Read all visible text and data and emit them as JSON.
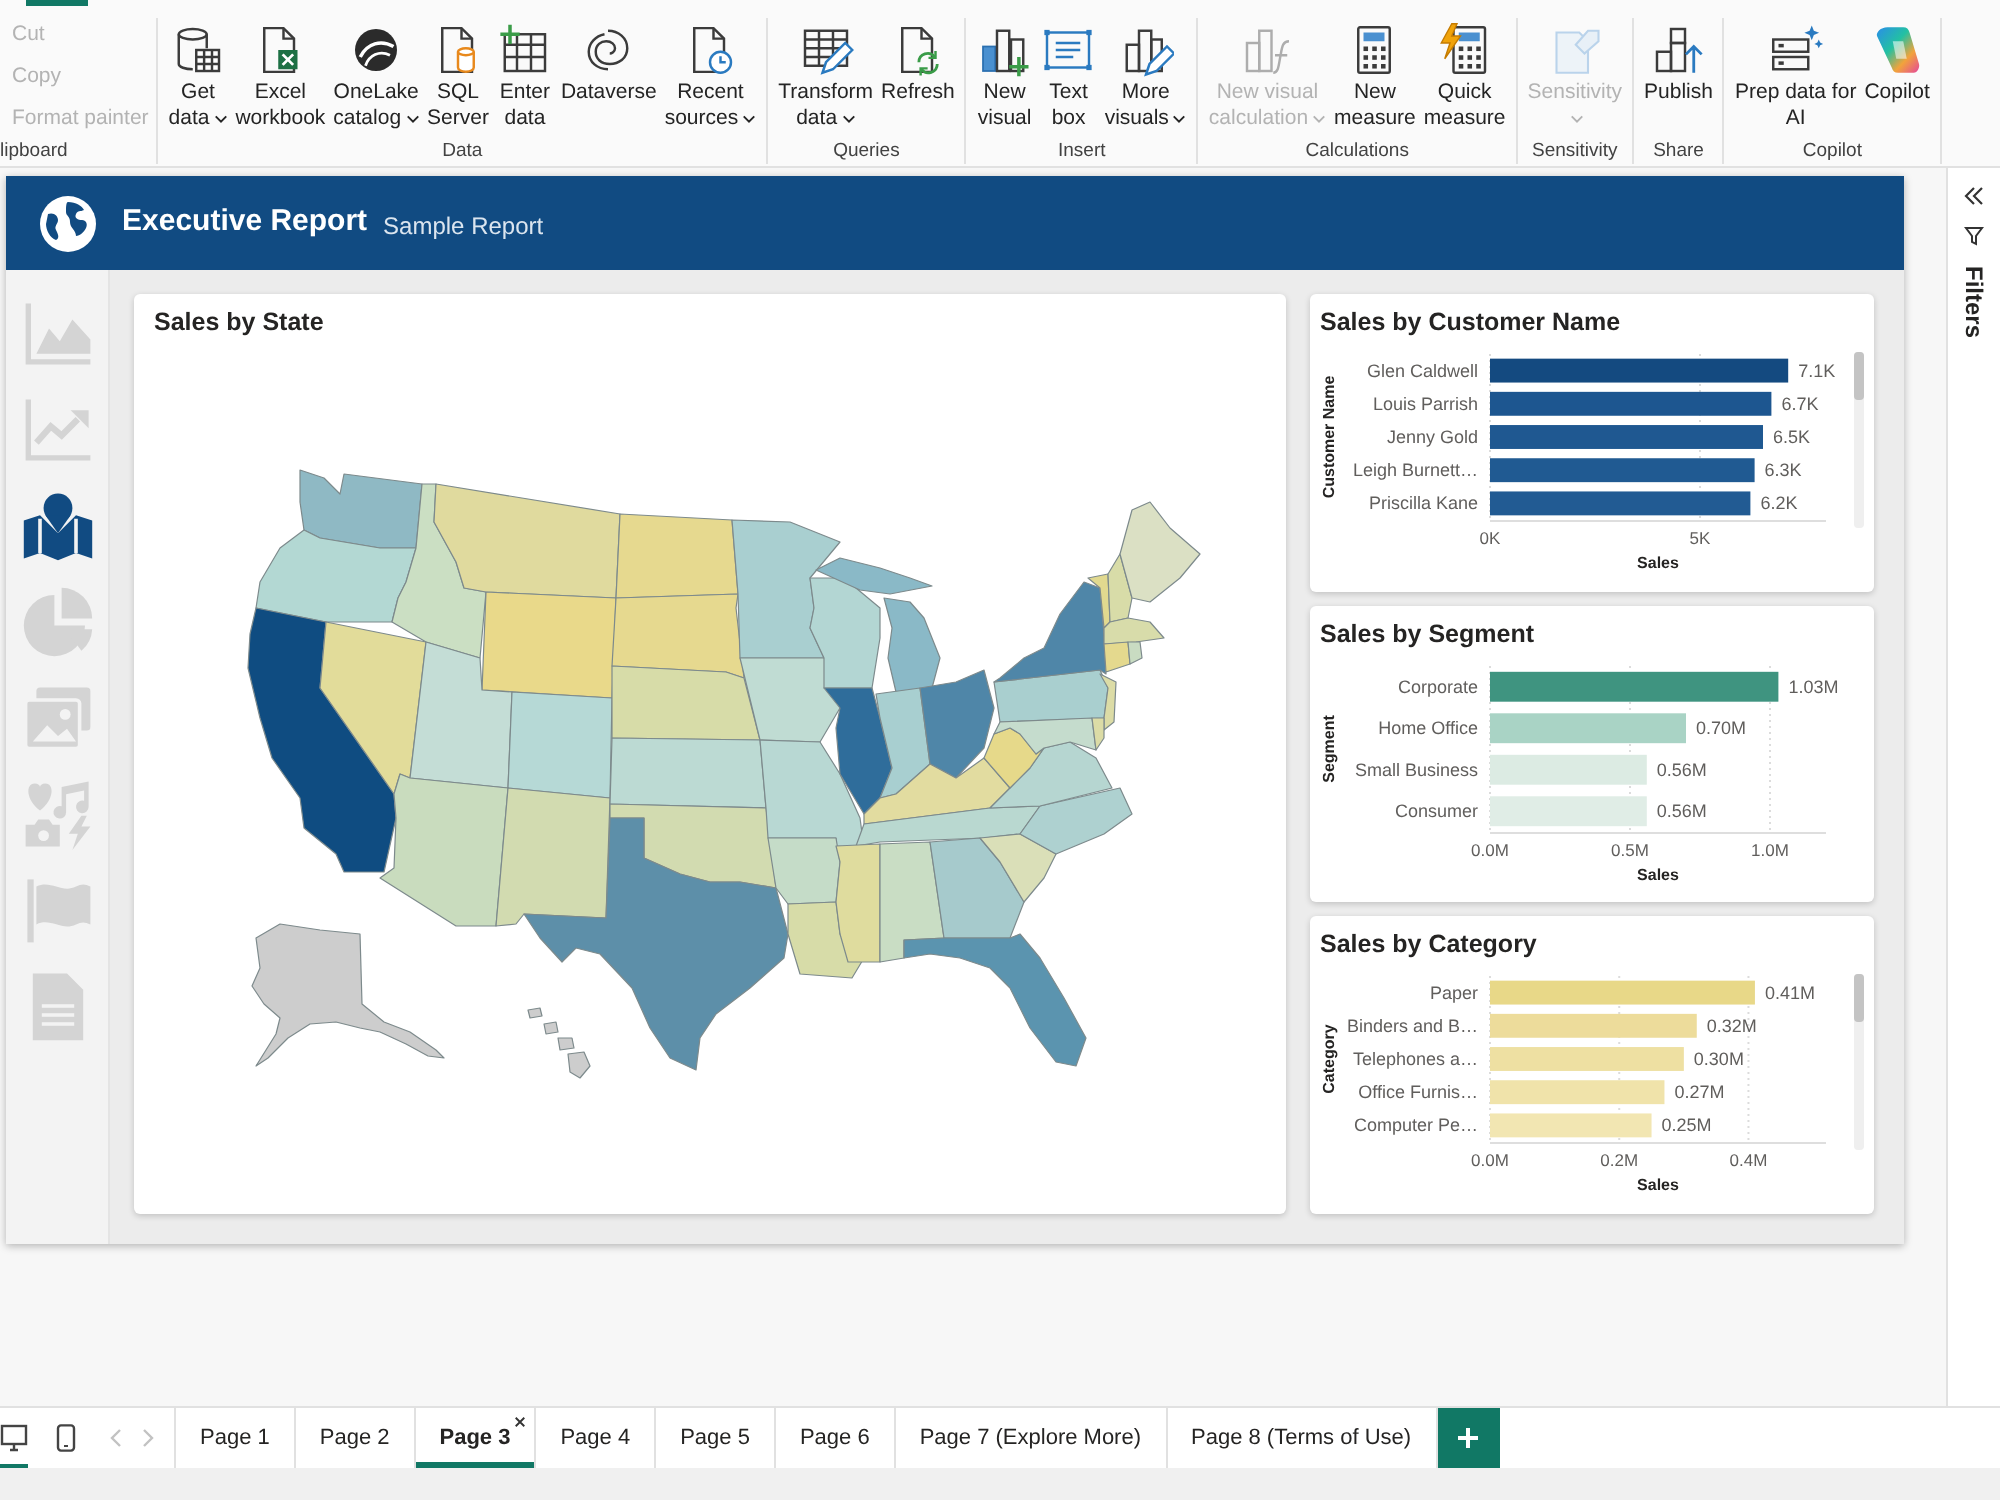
{
  "ribbon": {
    "groups": [
      {
        "kind": "stack",
        "label": "lipboard",
        "buttons": [
          {
            "label": [
              "Cut"
            ],
            "disabled": true,
            "dropdown": false
          },
          {
            "label": [
              "Copy"
            ],
            "disabled": true,
            "dropdown": false
          },
          {
            "label": [
              "Format painter"
            ],
            "disabled": true,
            "dropdown": false
          }
        ]
      },
      {
        "kind": "large",
        "label": "Data",
        "buttons": [
          {
            "kind": "getdata",
            "label": [
              "Get",
              "data"
            ],
            "dropdown": true,
            "disabled": false
          },
          {
            "kind": "excel",
            "label": [
              "Excel",
              "workbook"
            ],
            "dropdown": false,
            "disabled": false
          },
          {
            "kind": "onelake",
            "label": [
              "OneLake",
              "catalog"
            ],
            "dropdown": true,
            "disabled": false
          },
          {
            "kind": "sql",
            "label": [
              "SQL",
              "Server"
            ],
            "dropdown": false,
            "disabled": false
          },
          {
            "kind": "enterdata",
            "label": [
              "Enter",
              "data"
            ],
            "dropdown": false,
            "disabled": false
          },
          {
            "kind": "dataverse",
            "label": [
              "Dataverse"
            ],
            "dropdown": false,
            "disabled": false
          },
          {
            "kind": "recent",
            "label": [
              "Recent",
              "sources"
            ],
            "dropdown": true,
            "disabled": false
          }
        ]
      },
      {
        "kind": "large",
        "label": "Queries",
        "buttons": [
          {
            "kind": "transform",
            "label": [
              "Transform",
              "data"
            ],
            "dropdown": true,
            "disabled": false
          },
          {
            "kind": "refresh",
            "label": [
              "Refresh"
            ],
            "dropdown": false,
            "disabled": false
          }
        ]
      },
      {
        "kind": "large",
        "label": "Insert",
        "buttons": [
          {
            "kind": "newvisual",
            "label": [
              "New",
              "visual"
            ],
            "dropdown": false,
            "disabled": false
          },
          {
            "kind": "textbox",
            "label": [
              "Text",
              "box"
            ],
            "dropdown": false,
            "disabled": false
          },
          {
            "kind": "morevisuals",
            "label": [
              "More",
              "visuals"
            ],
            "dropdown": true,
            "disabled": false
          }
        ]
      },
      {
        "kind": "large",
        "label": "Calculations",
        "buttons": [
          {
            "kind": "visualcalc",
            "label": [
              "New visual",
              "calculation"
            ],
            "dropdown": true,
            "disabled": true
          },
          {
            "kind": "measure",
            "label": [
              "New",
              "measure"
            ],
            "dropdown": false,
            "disabled": false
          },
          {
            "kind": "quickmeasure",
            "label": [
              "Quick",
              "measure"
            ],
            "dropdown": false,
            "disabled": false
          }
        ]
      },
      {
        "kind": "large",
        "label": "Sensitivity",
        "buttons": [
          {
            "kind": "sensitivity",
            "label": [
              "Sensitivity"
            ],
            "dropdown": true,
            "disabled": true
          }
        ]
      },
      {
        "kind": "large",
        "label": "Share",
        "buttons": [
          {
            "kind": "publish",
            "label": [
              "Publish"
            ],
            "dropdown": false,
            "disabled": false
          }
        ]
      },
      {
        "kind": "large",
        "label": "Copilot",
        "buttons": [
          {
            "kind": "prepdata",
            "label": [
              "Prep data for",
              "AI"
            ],
            "dropdown": false,
            "disabled": false
          },
          {
            "kind": "copilot",
            "label": [
              "Copilot"
            ],
            "dropdown": false,
            "disabled": false
          }
        ]
      }
    ]
  },
  "report": {
    "title": "Executive Report",
    "subtitle": "Sample Report",
    "nav": [
      {
        "kind": "area",
        "selected": false
      },
      {
        "kind": "line",
        "selected": false
      },
      {
        "kind": "map",
        "selected": true
      },
      {
        "kind": "pie",
        "selected": false
      },
      {
        "kind": "gallery",
        "selected": false
      },
      {
        "kind": "media",
        "selected": false
      },
      {
        "kind": "flag",
        "selected": false
      },
      {
        "kind": "document",
        "selected": false
      }
    ],
    "visuals": [
      {
        "kind": "map",
        "title": "Sales by State"
      },
      {
        "kind": "bar",
        "title": "Sales by Customer Name",
        "chart_data": {
          "type": "bar",
          "orientation": "horizontal",
          "stacked": true,
          "xlabel": "Sales",
          "ylabel": "Customer Name",
          "categories": [
            "Glen Caldwell",
            "Louis Parrish",
            "Jenny Gold",
            "Leigh Burnett…",
            "Priscilla Kane"
          ],
          "series": [
            {
              "color": "#144a80",
              "values": [
                7.1,
                null,
                null,
                null,
                null
              ]
            },
            {
              "color": "#1d5690",
              "values": [
                null,
                6.7,
                null,
                null,
                null
              ]
            },
            {
              "color": "#1f5891",
              "values": [
                null,
                null,
                6.5,
                null,
                null
              ]
            },
            {
              "color": "#205a92",
              "values": [
                null,
                null,
                null,
                6.3,
                null
              ]
            },
            {
              "color": "#225b93",
              "values": [
                null,
                null,
                null,
                null,
                6.2
              ]
            }
          ],
          "xlim": [
            0,
            8
          ],
          "xticks": [
            {
              "value": 0,
              "label": "0K"
            },
            {
              "value": 5,
              "label": "5K"
            }
          ],
          "value_labels": [
            "7.1K",
            "6.7K",
            "6.5K",
            "6.3K",
            "6.2K"
          ]
        }
      },
      {
        "kind": "bar",
        "title": "Sales by Segment",
        "chart_data": {
          "type": "bar",
          "orientation": "horizontal",
          "stacked": true,
          "xlabel": "Sales",
          "ylabel": "Segment",
          "categories": [
            "Corporate",
            "Home Office",
            "Small Business",
            "Consumer"
          ],
          "series": [
            {
              "color": "#3f9480",
              "values": [
                1.03,
                null,
                null,
                null
              ]
            },
            {
              "color": "#a9d3c5",
              "values": [
                null,
                0.7,
                null,
                null
              ]
            },
            {
              "color": "#dcebe3",
              "values": [
                null,
                null,
                0.56,
                null
              ]
            },
            {
              "color": "#e0ede6",
              "values": [
                null,
                null,
                null,
                0.56
              ]
            }
          ],
          "xlim": [
            0,
            1.2
          ],
          "xticks": [
            {
              "value": 0,
              "label": "0.0M"
            },
            {
              "value": 0.5,
              "label": "0.5M"
            },
            {
              "value": 1,
              "label": "1.0M"
            }
          ],
          "value_labels": [
            "1.03M",
            "0.70M",
            "0.56M",
            "0.56M"
          ]
        }
      },
      {
        "kind": "bar",
        "title": "Sales by Category",
        "chart_data": {
          "type": "bar",
          "orientation": "horizontal",
          "stacked": true,
          "xlabel": "Sales",
          "ylabel": "Category",
          "categories": [
            "Paper",
            "Binders and B…",
            "Telephones a…",
            "Office Furnis…",
            "Computer Pe…"
          ],
          "series": [
            {
              "color": "#e8d888",
              "values": [
                0.41,
                null,
                null,
                null,
                null
              ]
            },
            {
              "color": "#eddc9b",
              "values": [
                null,
                0.32,
                null,
                null,
                null
              ]
            },
            {
              "color": "#eee0a2",
              "values": [
                null,
                null,
                0.3,
                null,
                null
              ]
            },
            {
              "color": "#f0e3aa",
              "values": [
                null,
                null,
                null,
                0.27,
                null
              ]
            },
            {
              "color": "#f2e6b2",
              "values": [
                null,
                null,
                null,
                null,
                0.25
              ]
            }
          ],
          "xlim": [
            0,
            0.52
          ],
          "xticks": [
            {
              "value": 0,
              "label": "0.0M"
            },
            {
              "value": 0.2,
              "label": "0.2M"
            },
            {
              "value": 0.4,
              "label": "0.4M"
            }
          ],
          "value_labels": [
            "0.41M",
            "0.32M",
            "0.30M",
            "0.27M",
            "0.25M"
          ]
        }
      }
    ]
  },
  "filters_pane": {
    "label": "Filters"
  },
  "page_bar": {
    "views": [
      {
        "kind": "desktop",
        "selected": true
      },
      {
        "kind": "mobile",
        "selected": false
      }
    ],
    "scroll": [
      {
        "kind": "prev",
        "disabled": true
      },
      {
        "kind": "next",
        "disabled": true
      }
    ],
    "tabs": [
      {
        "label": "Page 1",
        "selected": false
      },
      {
        "label": "Page 2",
        "selected": false
      },
      {
        "label": "Page 3",
        "selected": true
      },
      {
        "label": "Page 4",
        "selected": false
      },
      {
        "label": "Page 5",
        "selected": false
      },
      {
        "label": "Page 6",
        "selected": false
      },
      {
        "label": "Page 7 (Explore More)",
        "selected": false
      },
      {
        "label": "Page 8 (Terms of Use)",
        "selected": false
      }
    ]
  }
}
